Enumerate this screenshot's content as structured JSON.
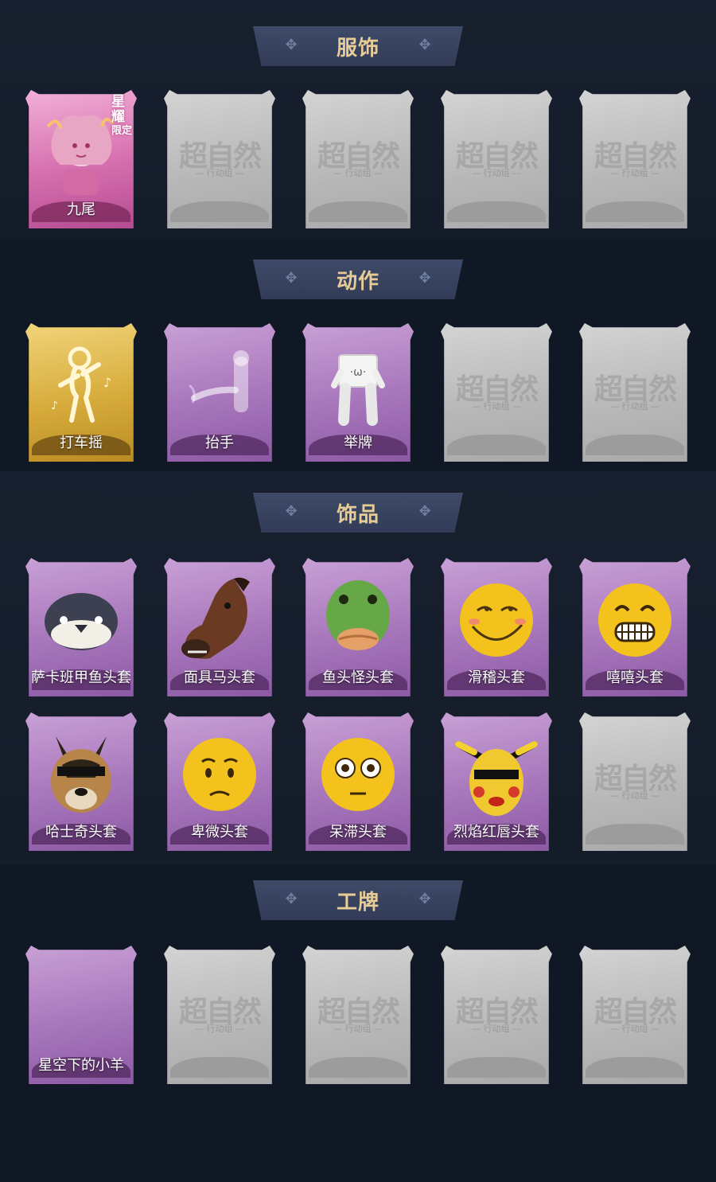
{
  "sections": [
    {
      "title": "服饰",
      "items": [
        {
          "label": "九尾",
          "style": "pink",
          "art": "character-portrait",
          "tag": "星耀",
          "tag_sub": "限定"
        },
        {
          "label": "",
          "style": "gray"
        },
        {
          "label": "",
          "style": "gray"
        },
        {
          "label": "",
          "style": "gray"
        },
        {
          "label": "",
          "style": "gray"
        }
      ]
    },
    {
      "title": "动作",
      "items": [
        {
          "label": "打车摇",
          "style": "gold",
          "art": "dance-icon"
        },
        {
          "label": "抬手",
          "style": "purple",
          "art": "raise-hand-icon"
        },
        {
          "label": "举牌",
          "style": "purple",
          "art": "hold-sign-icon"
        },
        {
          "label": "",
          "style": "gray"
        },
        {
          "label": "",
          "style": "gray"
        }
      ]
    },
    {
      "title": "饰品",
      "items": [
        {
          "label": "萨卡班甲鱼头套",
          "style": "purple",
          "art": "fish-head-icon"
        },
        {
          "label": "面具马头套",
          "style": "purple",
          "art": "horse-head-icon"
        },
        {
          "label": "鱼头怪头套",
          "style": "purple",
          "art": "fishman-head-icon"
        },
        {
          "label": "滑稽头套",
          "style": "purple",
          "art": "smirk-emoji-icon"
        },
        {
          "label": "嘻嘻头套",
          "style": "purple",
          "art": "grin-emoji-icon"
        },
        {
          "label": "哈士奇头套",
          "style": "purple",
          "art": "husky-head-icon"
        },
        {
          "label": "卑微头套",
          "style": "purple",
          "art": "humble-emoji-icon"
        },
        {
          "label": "呆滞头套",
          "style": "purple",
          "art": "dazed-emoji-icon"
        },
        {
          "label": "烈焰红唇头套",
          "style": "purple",
          "art": "pikachu-head-icon"
        },
        {
          "label": "",
          "style": "gray"
        }
      ]
    },
    {
      "title": "工牌",
      "items": [
        {
          "label": "星空下的小羊",
          "style": "purple",
          "art": ""
        },
        {
          "label": "",
          "style": "gray"
        },
        {
          "label": "",
          "style": "gray"
        },
        {
          "label": "",
          "style": "gray"
        },
        {
          "label": "",
          "style": "gray"
        }
      ]
    }
  ],
  "placeholder": {
    "watermark": "超自然",
    "watermark_sub": "— 行动组 —"
  },
  "colors": {
    "background": "#121a28",
    "banner": "#3a4562",
    "title": "#e8cc98"
  }
}
